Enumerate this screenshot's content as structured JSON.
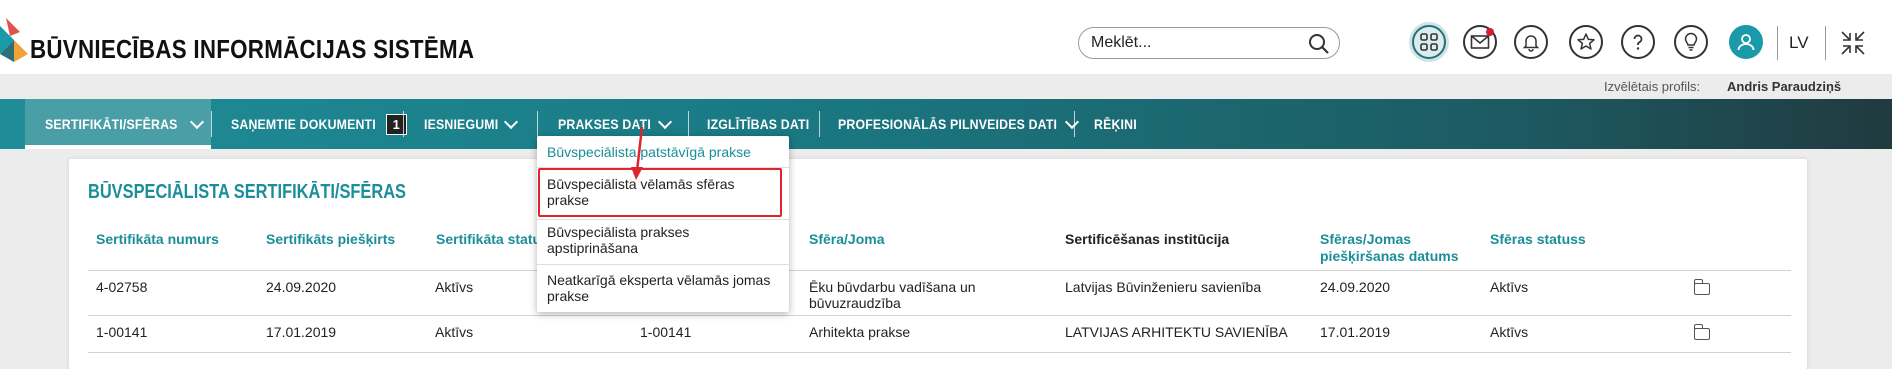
{
  "header": {
    "app_title": "BŪVNIECĪBAS INFORMĀCIJAS SISTĒMA",
    "search_placeholder": "Meklēt...",
    "language": "LV"
  },
  "profile": {
    "label": "Izvēlētais profils:",
    "name": "Andris Paraudziņš"
  },
  "nav": {
    "items": [
      {
        "label": "SERTIFIKĀTI/SFĒRAS",
        "has_dropdown": true,
        "active": true
      },
      {
        "label": "SAŅEMTIE DOKUMENTI",
        "badge": "1"
      },
      {
        "label": "IESNIEGUMI",
        "has_dropdown": true
      },
      {
        "label": "PRAKSES DATI",
        "has_dropdown": true
      },
      {
        "label": "IZGLĪTĪBAS DATI"
      },
      {
        "label": "PROFESIONĀLĀS PILNVEIDES DATI",
        "has_dropdown": true
      },
      {
        "label": "RĒĶINI"
      }
    ]
  },
  "dropdown": {
    "items": [
      {
        "label": "Būvspeciālista patstāvīgā prakse"
      },
      {
        "label": "Būvspeciālista vēlamās sfēras prakse",
        "highlighted": true
      },
      {
        "label": "Būvspeciālista prakses apstiprināšana"
      },
      {
        "label": "Neatkarīgā eksperta vēlamās jomas prakse"
      }
    ]
  },
  "section": {
    "title": "BŪVSPECIĀLISTA SERTIFIKĀTI/SFĒRAS"
  },
  "table": {
    "columns": [
      "Sertifikāta numurs",
      "Sertifikāts piešķirts",
      "Sertifikāta statuss",
      "Sfēra/Joma",
      "Sertificēšanas institūcija",
      "Sfēras/Jomas piešķiršanas datums",
      "Sfēras statuss"
    ],
    "col_statuss_visible": "Sertifikāta statu",
    "col_date_line1": "Sfēras/Jomas",
    "col_date_line2": "piešķiršanas datums",
    "rows": [
      {
        "cert_no": "4-02758",
        "granted": "24.09.2020",
        "status": "Aktīvs",
        "sphere_line1": "Ēku būvdarbu vadīšana un",
        "sphere_line2": "būvuzraudzība",
        "institution": "Latvijas Būvinženieru savienība",
        "sphere_date": "24.09.2020",
        "sphere_status": "Aktīvs"
      },
      {
        "cert_no": "1-00141",
        "granted": "17.01.2019",
        "status": "Aktīvs",
        "extra": "1-00141",
        "sphere_line1": "Arhitekta prakse",
        "sphere_line2": "",
        "institution": "LATVIJAS ARHITEKTU SAVIENĪBA",
        "sphere_date": "17.01.2019",
        "sphere_status": "Aktīvs"
      }
    ]
  },
  "colors": {
    "accent": "#1a8e99",
    "nav_start": "#1f8d98",
    "nav_end": "#203a3f",
    "highlight": "#e0242b"
  },
  "icons": [
    "logo-icon",
    "search-icon",
    "apps-grid-icon",
    "mail-icon",
    "bell-icon",
    "star-icon",
    "help-icon",
    "lightbulb-icon",
    "user-avatar-icon",
    "collapse-icon",
    "chevron-down-icon",
    "folder-icon"
  ]
}
